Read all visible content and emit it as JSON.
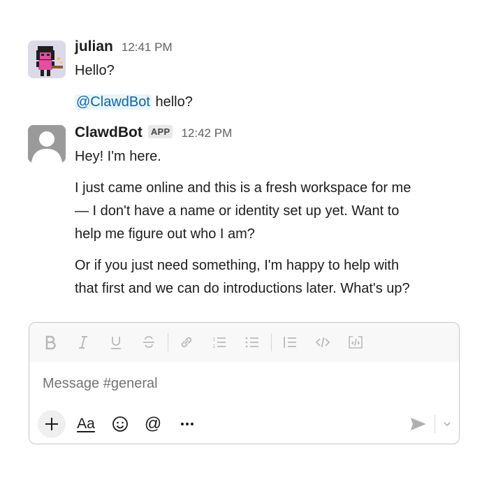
{
  "messages": [
    {
      "author": "julian",
      "time": "12:41 PM",
      "lines": [
        "Hello?"
      ],
      "mention": "@ClawdBot",
      "mention_rest": " hello?"
    },
    {
      "author": "ClawdBot",
      "badge": "APP",
      "time": "12:42 PM",
      "paragraphs": [
        "Hey! I'm here.",
        "I just came online and this is a fresh workspace for me",
        "— I don't have a name or identity set up yet. Want to",
        "help me figure out who I am?",
        "Or if you just need something, I'm happy to help with",
        "that first and we can do introductions later. What's up?"
      ]
    }
  ],
  "composer": {
    "placeholder": "Message #general",
    "format_tools": [
      "bold-icon",
      "italic-icon",
      "underline-icon",
      "strikethrough-icon",
      "link-icon",
      "ordered-list-icon",
      "bulleted-list-icon",
      "blockquote-icon",
      "code-icon",
      "code-block-icon"
    ],
    "text_format_label": "Aa"
  },
  "colors": {
    "mention_bg": "#e8f5fa",
    "mention_text": "#1264a3",
    "toolbar_bg": "#f8f8f8"
  }
}
